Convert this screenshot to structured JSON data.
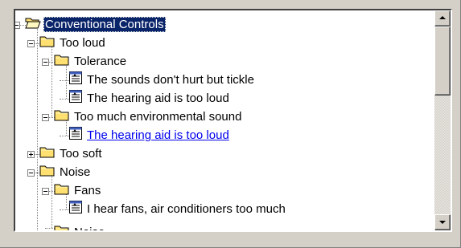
{
  "tree": {
    "items": [
      {
        "label": "Conventional Controls",
        "type": "folder-open",
        "state": "expanded",
        "selected": true
      },
      {
        "label": "Too loud",
        "type": "folder",
        "state": "expanded"
      },
      {
        "label": "Tolerance",
        "type": "folder",
        "state": "expanded"
      },
      {
        "label": "The sounds don't hurt but tickle",
        "type": "document"
      },
      {
        "label": "The hearing aid is too loud",
        "type": "document"
      },
      {
        "label": "Too much environmental sound",
        "type": "folder",
        "state": "expanded"
      },
      {
        "label": "The hearing aid is too loud",
        "type": "document",
        "hover": true
      },
      {
        "label": "Too soft",
        "type": "folder",
        "state": "collapsed"
      },
      {
        "label": "Noise",
        "type": "folder",
        "state": "expanded"
      },
      {
        "label": "Fans",
        "type": "folder",
        "state": "expanded"
      },
      {
        "label": "I hear fans, air conditioners too much",
        "type": "document"
      },
      {
        "label": "Noise",
        "type": "folder",
        "state": "partial"
      }
    ]
  },
  "scrollbar": {
    "up_icon": "arrow-up-icon",
    "down_icon": "arrow-down-icon",
    "position": 0
  },
  "colors": {
    "selection_bg": "#0a246a",
    "link": "#0000ee",
    "folder": "#ffe070"
  }
}
